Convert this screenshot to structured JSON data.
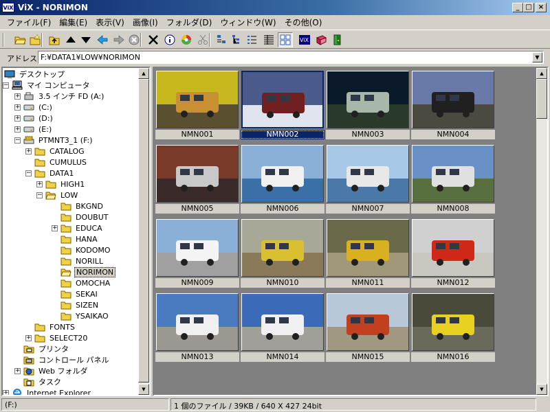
{
  "window": {
    "app_icon_text": "ViX",
    "title": "ViX - NORIMON",
    "min_label": "_",
    "max_label": "□",
    "close_label": "×"
  },
  "menu": [
    "ファイル(F)",
    "編集(E)",
    "表示(V)",
    "画像(I)",
    "フォルダ(D)",
    "ウィンドウ(W)",
    "その他(O)"
  ],
  "toolbar": {
    "icons": [
      "open-folder-icon",
      "new-folder-icon",
      "up-folder-icon",
      "up-arrow-icon",
      "down-arrow-icon",
      "back-icon",
      "forward-icon",
      "stop-icon",
      "delete-icon",
      "info-icon",
      "color-icon",
      "cut-icon",
      "small-icons-view-icon",
      "tree-view-icon",
      "list-view-icon",
      "details-view-icon",
      "thumbnail-view-icon",
      "vix-icon",
      "book-icon",
      "exit-icon"
    ]
  },
  "address": {
    "label": "アドレス",
    "value": "F:¥DATA1¥LOW¥NORIMON"
  },
  "tree": [
    {
      "label": "デスクトップ",
      "icon": "desktop-icon",
      "depth": 0,
      "exp": ""
    },
    {
      "label": "マイ コンピュータ",
      "icon": "computer-icon",
      "depth": 1,
      "exp": "-"
    },
    {
      "label": "3.5 インチ FD (A:)",
      "icon": "floppy-icon",
      "depth": 2,
      "exp": "+"
    },
    {
      "label": "(C:)",
      "icon": "drive-icon",
      "depth": 2,
      "exp": "+"
    },
    {
      "label": "(D:)",
      "icon": "drive-icon",
      "depth": 2,
      "exp": "+"
    },
    {
      "label": "(E:)",
      "icon": "drive-icon",
      "depth": 2,
      "exp": "+"
    },
    {
      "label": "PTMNT3_1 (F:)",
      "icon": "cdrom-icon",
      "depth": 2,
      "exp": "-"
    },
    {
      "label": "CATALOG",
      "icon": "folder-icon",
      "depth": 3,
      "exp": "+"
    },
    {
      "label": "CUMULUS",
      "icon": "folder-icon",
      "depth": 3,
      "exp": ""
    },
    {
      "label": "DATA1",
      "icon": "folder-icon",
      "depth": 3,
      "exp": "-"
    },
    {
      "label": "HIGH1",
      "icon": "folder-icon",
      "depth": 4,
      "exp": "+"
    },
    {
      "label": "LOW",
      "icon": "folder-open-icon",
      "depth": 4,
      "exp": "-"
    },
    {
      "label": "BKGND",
      "icon": "folder-icon",
      "depth": 5,
      "exp": ""
    },
    {
      "label": "DOUBUT",
      "icon": "folder-icon",
      "depth": 5,
      "exp": ""
    },
    {
      "label": "EDUCA",
      "icon": "folder-icon",
      "depth": 5,
      "exp": "+"
    },
    {
      "label": "HANA",
      "icon": "folder-icon",
      "depth": 5,
      "exp": ""
    },
    {
      "label": "KODOMO",
      "icon": "folder-icon",
      "depth": 5,
      "exp": ""
    },
    {
      "label": "NORILL",
      "icon": "folder-icon",
      "depth": 5,
      "exp": ""
    },
    {
      "label": "NORIMON",
      "icon": "folder-open-icon",
      "depth": 5,
      "exp": "",
      "selected": true
    },
    {
      "label": "OMOCHA",
      "icon": "folder-icon",
      "depth": 5,
      "exp": ""
    },
    {
      "label": "SEKAI",
      "icon": "folder-icon",
      "depth": 5,
      "exp": ""
    },
    {
      "label": "SIZEN",
      "icon": "folder-icon",
      "depth": 5,
      "exp": ""
    },
    {
      "label": "YSAIKAO",
      "icon": "folder-icon",
      "depth": 5,
      "exp": ""
    },
    {
      "label": "FONTS",
      "icon": "folder-icon",
      "depth": 3,
      "exp": ""
    },
    {
      "label": "SELECT20",
      "icon": "folder-icon",
      "depth": 3,
      "exp": "+"
    },
    {
      "label": "プリンタ",
      "icon": "printer-folder-icon",
      "depth": 2,
      "exp": ""
    },
    {
      "label": "コントロール パネル",
      "icon": "control-panel-icon",
      "depth": 2,
      "exp": ""
    },
    {
      "label": "Web フォルダ",
      "icon": "web-folder-icon",
      "depth": 2,
      "exp": "+"
    },
    {
      "label": "タスク",
      "icon": "task-folder-icon",
      "depth": 2,
      "exp": ""
    },
    {
      "label": "Internet Explorer",
      "icon": "ie-icon",
      "depth": 1,
      "exp": "+"
    }
  ],
  "thumbnails": [
    {
      "name": "NMN001",
      "sky": "#c8b820",
      "ground": "#5a5030",
      "subject": "#c89030"
    },
    {
      "name": "NMN002",
      "sky": "#4a5a8a",
      "ground": "#e0e4ee",
      "subject": "#702020",
      "selected": true
    },
    {
      "name": "NMN003",
      "sky": "#0a1a2a",
      "ground": "#2a3a2a",
      "subject": "#a8b8a8"
    },
    {
      "name": "NMN004",
      "sky": "#6a7aa8",
      "ground": "#4a4a40",
      "subject": "#202020"
    },
    {
      "name": "NMN005",
      "sky": "#7a3a2a",
      "ground": "#3a2a2a",
      "subject": "#c8c8c8"
    },
    {
      "name": "NMN006",
      "sky": "#8ab0d8",
      "ground": "#3a70a8",
      "subject": "#f0f0f0"
    },
    {
      "name": "NMN007",
      "sky": "#a8c8e8",
      "ground": "#4a78a8",
      "subject": "#e8e8e8"
    },
    {
      "name": "NMN008",
      "sky": "#6a90c8",
      "ground": "#587040",
      "subject": "#e0e0e0"
    },
    {
      "name": "NMN009",
      "sky": "#8ab0d8",
      "ground": "#a0a0a0",
      "subject": "#f4f4f4"
    },
    {
      "name": "NMN010",
      "sky": "#a8a898",
      "ground": "#8a7a5a",
      "subject": "#d8c030"
    },
    {
      "name": "NMN011",
      "sky": "#6a6a4a",
      "ground": "#a09878",
      "subject": "#d8b020"
    },
    {
      "name": "NMN012",
      "sky": "#d0d0d0",
      "ground": "#c8c8c0",
      "subject": "#d02818"
    },
    {
      "name": "NMN013",
      "sky": "#4a7ac0",
      "ground": "#9a9890",
      "subject": "#f0f0f0"
    },
    {
      "name": "NMN014",
      "sky": "#3a6ab8",
      "ground": "#a0a098",
      "subject": "#f0f0f0"
    },
    {
      "name": "NMN015",
      "sky": "#b8c8d8",
      "ground": "#a09880",
      "subject": "#c04020"
    },
    {
      "name": "NMN016",
      "sky": "#4a4a3a",
      "ground": "#6a6a5a",
      "subject": "#e8d020"
    }
  ],
  "status": {
    "drive": "(F:)",
    "info": "1 個のファイル / 39KB / 640 X 427 24bit"
  }
}
